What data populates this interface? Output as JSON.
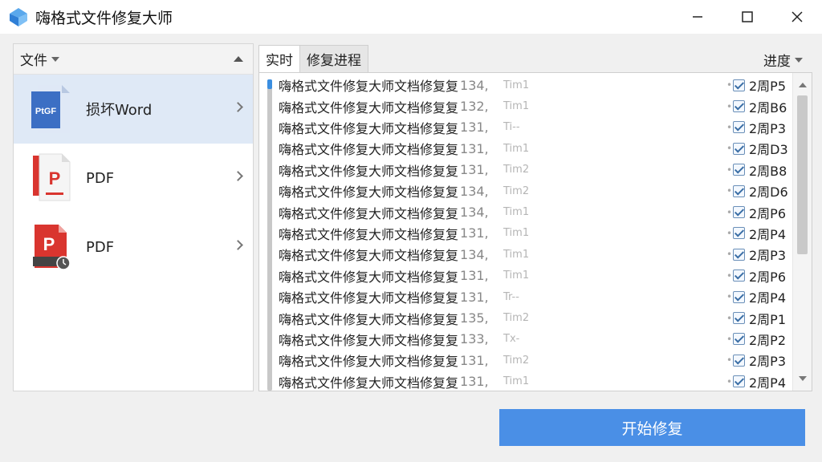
{
  "window": {
    "title": "嗨格式文件修复大师"
  },
  "left": {
    "header_label": "文件",
    "items": [
      {
        "label": "损坏Word",
        "icon": "word-file-icon",
        "selected": true
      },
      {
        "label": "PDF",
        "icon": "pdf-file-icon",
        "selected": false
      },
      {
        "label": "PDF",
        "icon": "pdf-clock-file-icon",
        "selected": false
      }
    ]
  },
  "tabs": [
    {
      "label": "实时"
    },
    {
      "label": "修复进程"
    }
  ],
  "progress_label": "进度",
  "rows": [
    {
      "name": "嗨格式文件修复大师文档修复复",
      "num": "134,",
      "extra": "Tim1",
      "code": "2周P5"
    },
    {
      "name": "嗨格式文件修复大师文档修复复",
      "num": "132,",
      "extra": "Tim1",
      "code": "2周B6"
    },
    {
      "name": "嗨格式文件修复大师文档修复复",
      "num": "131,",
      "extra": "Ti--",
      "code": "2周P3"
    },
    {
      "name": "嗨格式文件修复大师文档修复复",
      "num": "131,",
      "extra": "Tim1",
      "code": "2周D3"
    },
    {
      "name": "嗨格式文件修复大师文档修复复",
      "num": "131,",
      "extra": "Tim2",
      "code": "2周B8"
    },
    {
      "name": "嗨格式文件修复大师文档修复复",
      "num": "134,",
      "extra": "Tim2",
      "code": "2周D6"
    },
    {
      "name": "嗨格式文件修复大师文档修复复",
      "num": "134,",
      "extra": "Tim1",
      "code": "2周P6"
    },
    {
      "name": "嗨格式文件修复大师文档修复复",
      "num": "131,",
      "extra": "Tim1",
      "code": "2周P4"
    },
    {
      "name": "嗨格式文件修复大师文档修复复",
      "num": "134,",
      "extra": "Tim1",
      "code": "2周P3"
    },
    {
      "name": "嗨格式文件修复大师文档修复复",
      "num": "131,",
      "extra": "Tim1",
      "code": "2周P6"
    },
    {
      "name": "嗨格式文件修复大师文档修复复",
      "num": "131,",
      "extra": "Tr--",
      "code": "2周P4"
    },
    {
      "name": "嗨格式文件修复大师文档修复复",
      "num": "135,",
      "extra": "Tim2",
      "code": "2周P1"
    },
    {
      "name": "嗨格式文件修复大师文档修复复",
      "num": "133,",
      "extra": "Tx-",
      "code": "2周P2"
    },
    {
      "name": "嗨格式文件修复大师文档修复复",
      "num": "131,",
      "extra": "Tim2",
      "code": "2周P3"
    },
    {
      "name": "嗨格式文件修复大师文档修复复",
      "num": "131,",
      "extra": "Tim1",
      "code": "2周P4"
    }
  ],
  "start_button": "开始修复",
  "colors": {
    "accent": "#4a8fe6",
    "selected_bg": "#dfe9f6"
  }
}
